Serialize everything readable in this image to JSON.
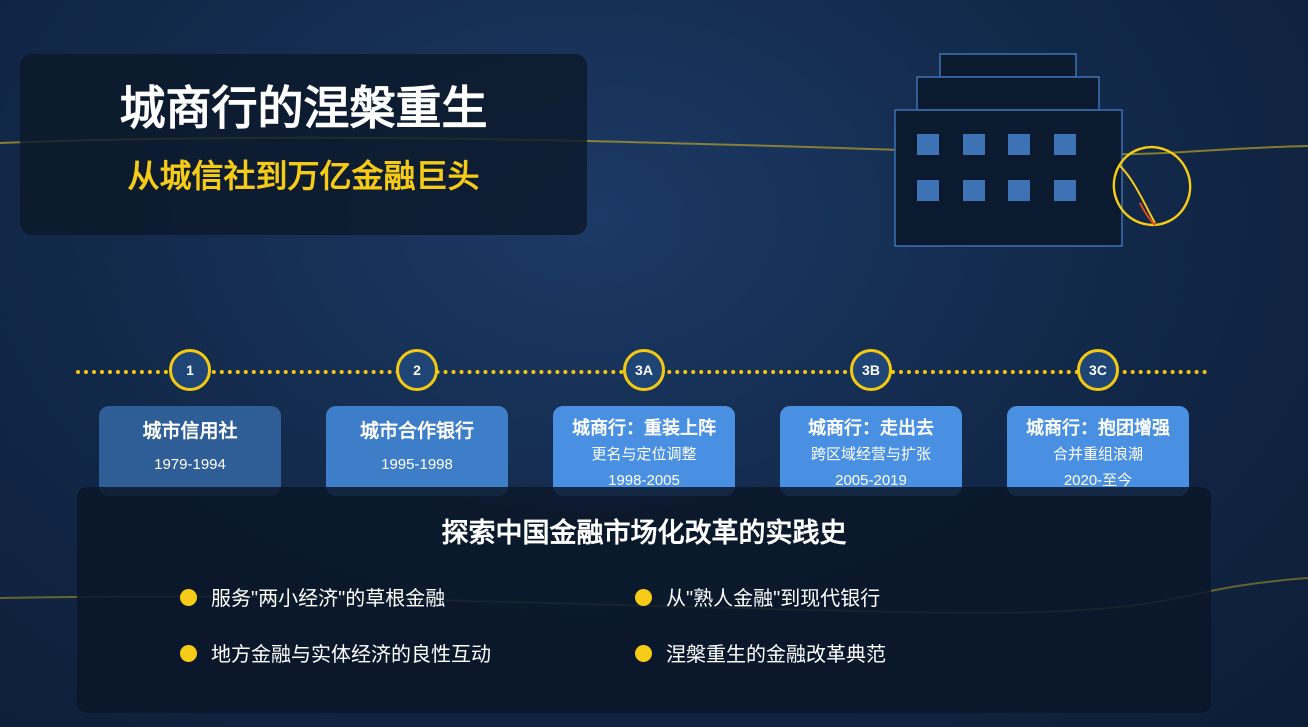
{
  "title": {
    "main": "城商行的涅槃重生",
    "sub": "从城信社到万亿金融巨头"
  },
  "timeline": {
    "nodes": [
      "1",
      "2",
      "3A",
      "3B",
      "3C"
    ],
    "stages": [
      {
        "title": "城市信用社",
        "date": "1979-1994"
      },
      {
        "title": "城市合作银行",
        "date": "1995-1998"
      },
      {
        "title": "城商行：重装上阵",
        "desc": "更名与定位调整",
        "date": "1998-2005"
      },
      {
        "title": "城商行：走出去",
        "desc": "跨区域经营与扩张",
        "date": "2005-2019"
      },
      {
        "title": "城商行：抱团增强",
        "desc": "合并重组浪潮",
        "date": "2020-至今"
      }
    ]
  },
  "summary": {
    "title": "探索中国金融市场化改革的实践史",
    "points": [
      "服务\"两小经济\"的草根金融",
      "从\"熟人金融\"到现代银行",
      "地方金融与实体经济的良性互动",
      "涅槃重生的金融改革典范"
    ]
  },
  "colors": {
    "accent": "#f5cb17",
    "card_dark": "#2f5d96",
    "card_mid": "#3e7dc8",
    "card_light": "#4a90e2",
    "window_blue": "#3d72b4"
  },
  "icons": [
    "bank-building-icon",
    "phoenix-egg-icon"
  ]
}
